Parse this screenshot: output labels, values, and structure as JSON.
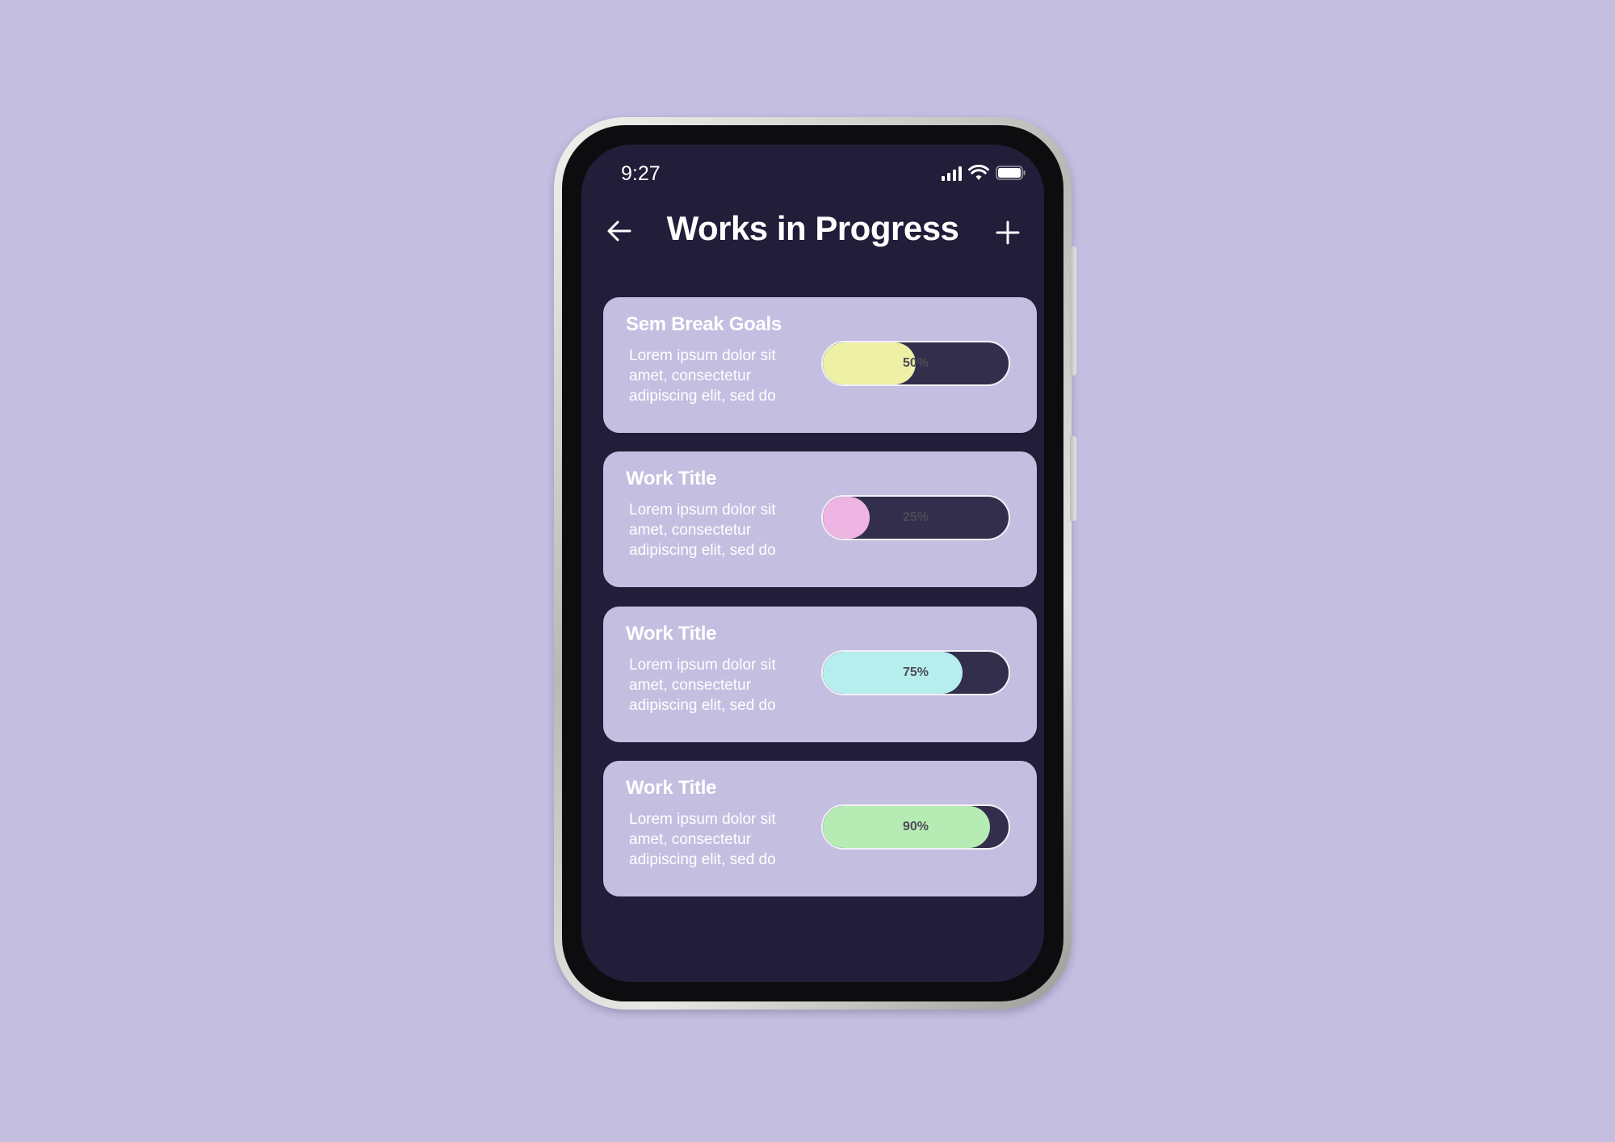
{
  "status_bar": {
    "time": "9:27",
    "icons": [
      "signal-icon",
      "wifi-icon",
      "battery-icon"
    ]
  },
  "header": {
    "title": "Works in Progress",
    "back_icon": "arrow-left-icon",
    "add_icon": "plus-icon"
  },
  "cards": [
    {
      "title": "Sem Break Goals",
      "description": "Lorem ipsum dolor sit amet, consectetur adipiscing elit, sed do",
      "progress_label": "50%",
      "progress": 0.5,
      "color": "#eef0a6"
    },
    {
      "title": "Work Title",
      "description": "Lorem ipsum dolor sit amet, consectetur adipiscing elit, sed do",
      "progress_label": "25%",
      "progress": 0.25,
      "color": "#eeb4e2"
    },
    {
      "title": "Work Title",
      "description": "Lorem ipsum dolor sit amet, consectetur adipiscing elit, sed do",
      "progress_label": "75%",
      "progress": 0.75,
      "color": "#b6eeee"
    },
    {
      "title": "Work Title",
      "description": "Lorem ipsum dolor sit amet, consectetur adipiscing elit, sed do",
      "progress_label": "90%",
      "progress": 0.9,
      "color": "#b6ecb4"
    }
  ],
  "colors": {
    "background": "#c4bee0",
    "screen": "#221d38",
    "card": "#c4bee0",
    "track": "#342e4d"
  }
}
